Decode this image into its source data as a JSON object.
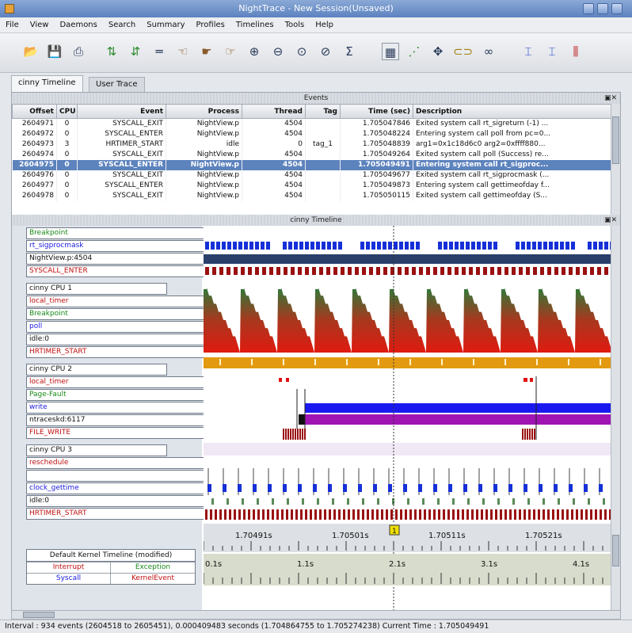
{
  "window": {
    "title": "NightTrace - New Session(Unsaved)"
  },
  "menu": [
    "File",
    "View",
    "Daemons",
    "Search",
    "Summary",
    "Profiles",
    "Timelines",
    "Tools",
    "Help"
  ],
  "tabs": [
    {
      "label": "cinny Timeline",
      "active": true
    },
    {
      "label": "User Trace",
      "active": false
    }
  ],
  "events_pane": {
    "title": "Events",
    "columns": [
      "Offset",
      "CPU",
      "Event",
      "Process",
      "Thread",
      "Tag",
      "Time (sec)",
      "Description"
    ],
    "rows": [
      {
        "offset": "2604971",
        "cpu": "0",
        "event": "SYSCALL_EXIT",
        "process": "NightView.p",
        "thread": "4504",
        "tag": "",
        "time": "1.705047846",
        "desc": "Exited system call rt_sigreturn (-1) ..."
      },
      {
        "offset": "2604972",
        "cpu": "0",
        "event": "SYSCALL_ENTER",
        "process": "NightView.p",
        "thread": "4504",
        "tag": "",
        "time": "1.705048224",
        "desc": "Entering system call poll from pc=0..."
      },
      {
        "offset": "2604973",
        "cpu": "3",
        "event": "HRTIMER_START",
        "process": "idle",
        "thread": "0",
        "tag": "tag_1",
        "time": "1.705048839",
        "desc": "arg1=0x1c18d6c0 arg2=0xffff880..."
      },
      {
        "offset": "2604974",
        "cpu": "0",
        "event": "SYSCALL_EXIT",
        "process": "NightView.p",
        "thread": "4504",
        "tag": "",
        "time": "1.705049264",
        "desc": "Exited system call poll (Success) re..."
      },
      {
        "offset": "2604975",
        "cpu": "0",
        "event": "SYSCALL_ENTER",
        "process": "NightView.p",
        "thread": "4504",
        "tag": "",
        "time": "1.705049491",
        "desc": "Entering system call rt_sigproc...",
        "selected": true
      },
      {
        "offset": "2604976",
        "cpu": "0",
        "event": "SYSCALL_EXIT",
        "process": "NightView.p",
        "thread": "4504",
        "tag": "",
        "time": "1.705049677",
        "desc": "Exited system call rt_sigprocmask (..."
      },
      {
        "offset": "2604977",
        "cpu": "0",
        "event": "SYSCALL_ENTER",
        "process": "NightView.p",
        "thread": "4504",
        "tag": "",
        "time": "1.705049873",
        "desc": "Entering system call gettimeofday f..."
      },
      {
        "offset": "2604978",
        "cpu": "0",
        "event": "SYSCALL_EXIT",
        "process": "NightView.p",
        "thread": "4504",
        "tag": "",
        "time": "1.705050115",
        "desc": "Exited system call gettimeofday (S..."
      }
    ]
  },
  "timeline_pane": {
    "title": "cinny Timeline",
    "rows": [
      {
        "label": "Breakpoint",
        "color": "#1a8a1a"
      },
      {
        "label": "rt_sigprocmask",
        "color": "#1a1ae0"
      },
      {
        "label": "NightView.p:4504",
        "color": "#111111"
      },
      {
        "label": "SYSCALL_ENTER",
        "color": "#c01010"
      },
      {
        "label": "cinny CPU 1",
        "color": "#111111",
        "group": true
      },
      {
        "label": "local_timer",
        "color": "#c01010"
      },
      {
        "label": "Breakpoint",
        "color": "#1a8a1a"
      },
      {
        "label": "poll",
        "color": "#1a1ae0"
      },
      {
        "label": "idle:0",
        "color": "#111111"
      },
      {
        "label": "HRTIMER_START",
        "color": "#c01010"
      },
      {
        "label": "cinny CPU 2",
        "color": "#111111",
        "group": true
      },
      {
        "label": "local_timer",
        "color": "#c01010"
      },
      {
        "label": "Page-Fault",
        "color": "#1a8a1a"
      },
      {
        "label": "write",
        "color": "#1a1ae0"
      },
      {
        "label": "ntraceskd:6117",
        "color": "#111111"
      },
      {
        "label": "FILE_WRITE",
        "color": "#c01010"
      },
      {
        "label": "cinny CPU 3",
        "color": "#111111",
        "group": true
      },
      {
        "label": "reschedule",
        "color": "#c01010"
      },
      {
        "label": "",
        "color": "#111111"
      },
      {
        "label": "clock_gettime",
        "color": "#1a1ae0"
      },
      {
        "label": "idle:0",
        "color": "#111111"
      },
      {
        "label": "HRTIMER_START",
        "color": "#c01010"
      }
    ],
    "ruler_top": [
      "1.70491s",
      "1.70501s",
      "1.70511s",
      "1.70521s"
    ],
    "ruler_bottom": [
      "0.1s",
      "1.1s",
      "2.1s",
      "3.1s",
      "4.1s"
    ],
    "cursor_marker": "1",
    "legend": {
      "title": "Default Kernel Timeline (modified)",
      "items": [
        {
          "label": "Interrupt",
          "color": "#c01010"
        },
        {
          "label": "Exception",
          "color": "#1a8a1a"
        },
        {
          "label": "Syscall",
          "color": "#1a1ae0"
        },
        {
          "label": "KernelEvent",
          "color": "#c01010"
        }
      ]
    }
  },
  "status": "Interval : 934 events (2604518 to 2605451), 0.000409483 seconds (1.704864755 to 1.705274238)     Current Time : 1.705049491"
}
